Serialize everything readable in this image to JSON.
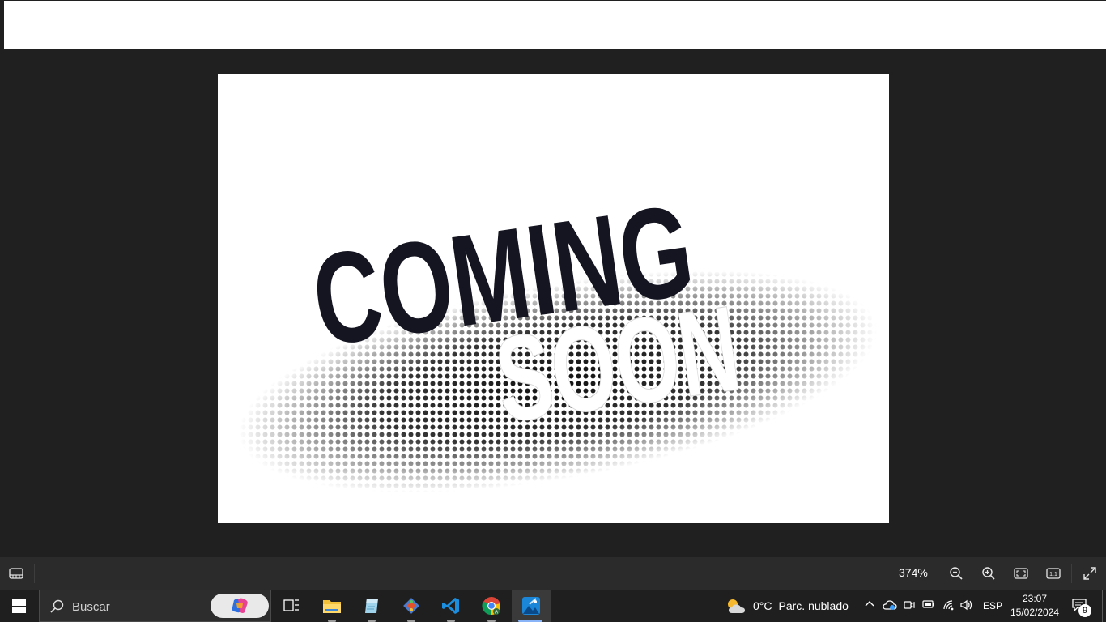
{
  "viewer": {
    "image": {
      "line1": "COMING",
      "line2": "SOON"
    }
  },
  "statusbar": {
    "zoom_level": "374%",
    "icons": [
      "filmstrip-icon",
      "zoom-out-icon",
      "zoom-in-icon",
      "fit-to-window-icon",
      "actual-size-icon",
      "fullscreen-icon"
    ],
    "actual_size_label": "1:1"
  },
  "taskbar": {
    "search_placeholder": "Buscar",
    "apps": [
      "windows-start-icon",
      "task-view-icon",
      "file-explorer-icon",
      "notepad-icon",
      "git-icon",
      "vscode-icon",
      "chrome-icon",
      "photos-icon"
    ],
    "weather": {
      "temperature": "0°C",
      "condition": "Parc. nublado"
    },
    "language": "ESP",
    "time": "23:07",
    "date": "15/02/2024",
    "notification_count": "9"
  },
  "colors": {
    "background": "#202020",
    "statusbar": "#2b2b2b",
    "taskbar": "#1f1f1f",
    "accent": "#0078d4"
  }
}
